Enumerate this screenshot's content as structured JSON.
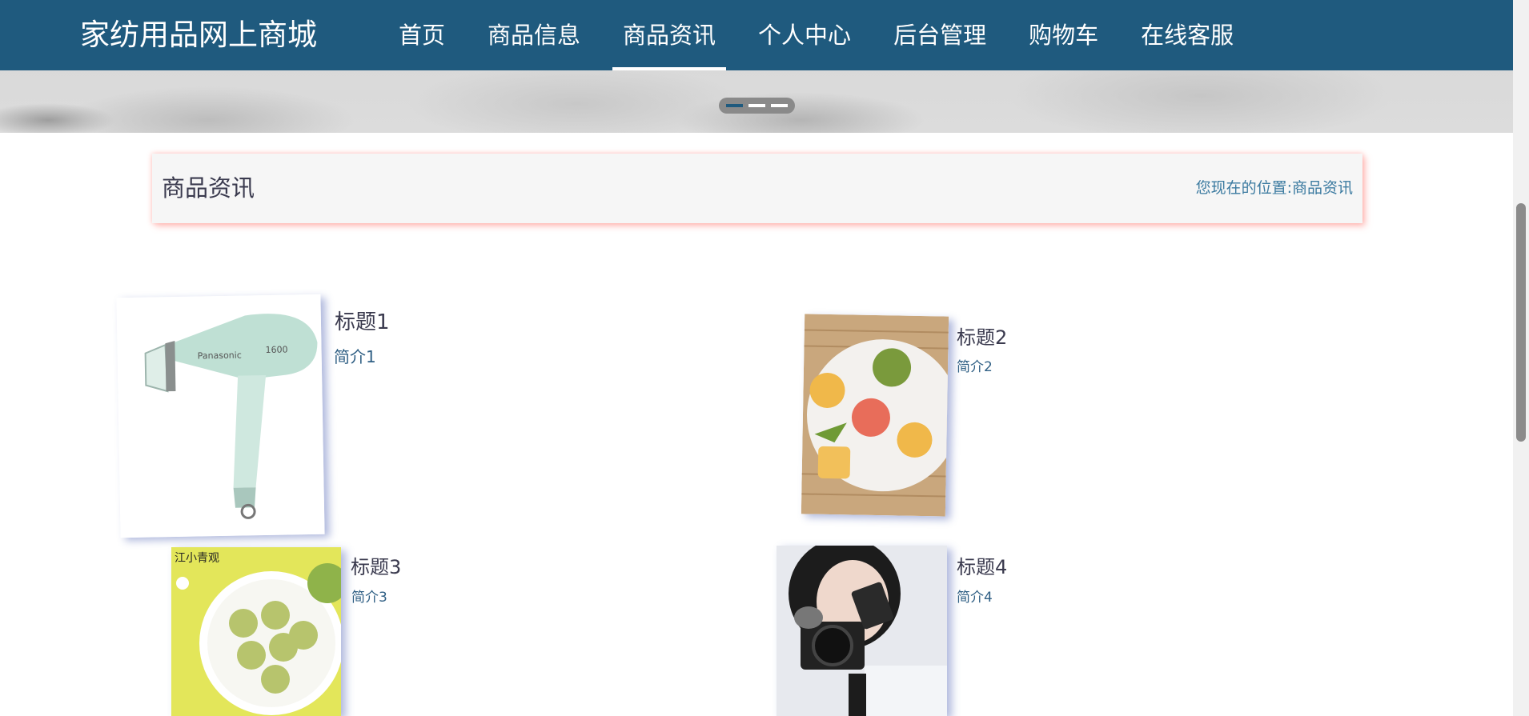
{
  "brand": {
    "title": "家纺用品网上商城"
  },
  "nav": {
    "items": [
      {
        "label": "首页"
      },
      {
        "label": "商品信息"
      },
      {
        "label": "商品资讯"
      },
      {
        "label": "个人中心"
      },
      {
        "label": "后台管理"
      },
      {
        "label": "购物车"
      },
      {
        "label": "在线客服"
      }
    ],
    "active_index": 2
  },
  "banner": {
    "slides": 3,
    "active_slide": 1
  },
  "breadcrumb": {
    "page_title": "商品资讯",
    "location_prefix": "您现在的位置:",
    "location_link": "商品资讯"
  },
  "news": [
    {
      "title": "标题1",
      "intro": "简介1",
      "image": "hair-dryer"
    },
    {
      "title": "标题2",
      "intro": "简介2",
      "image": "mooncakes-plate"
    },
    {
      "title": "标题3",
      "intro": "简介3",
      "image": "matcha-cookies"
    },
    {
      "title": "标题4",
      "intro": "简介4",
      "image": "camera-vlogger"
    }
  ],
  "colors": {
    "nav_bg": "#1f5a7e",
    "link": "#3b7aa0",
    "title_text": "#3a3a4e"
  }
}
